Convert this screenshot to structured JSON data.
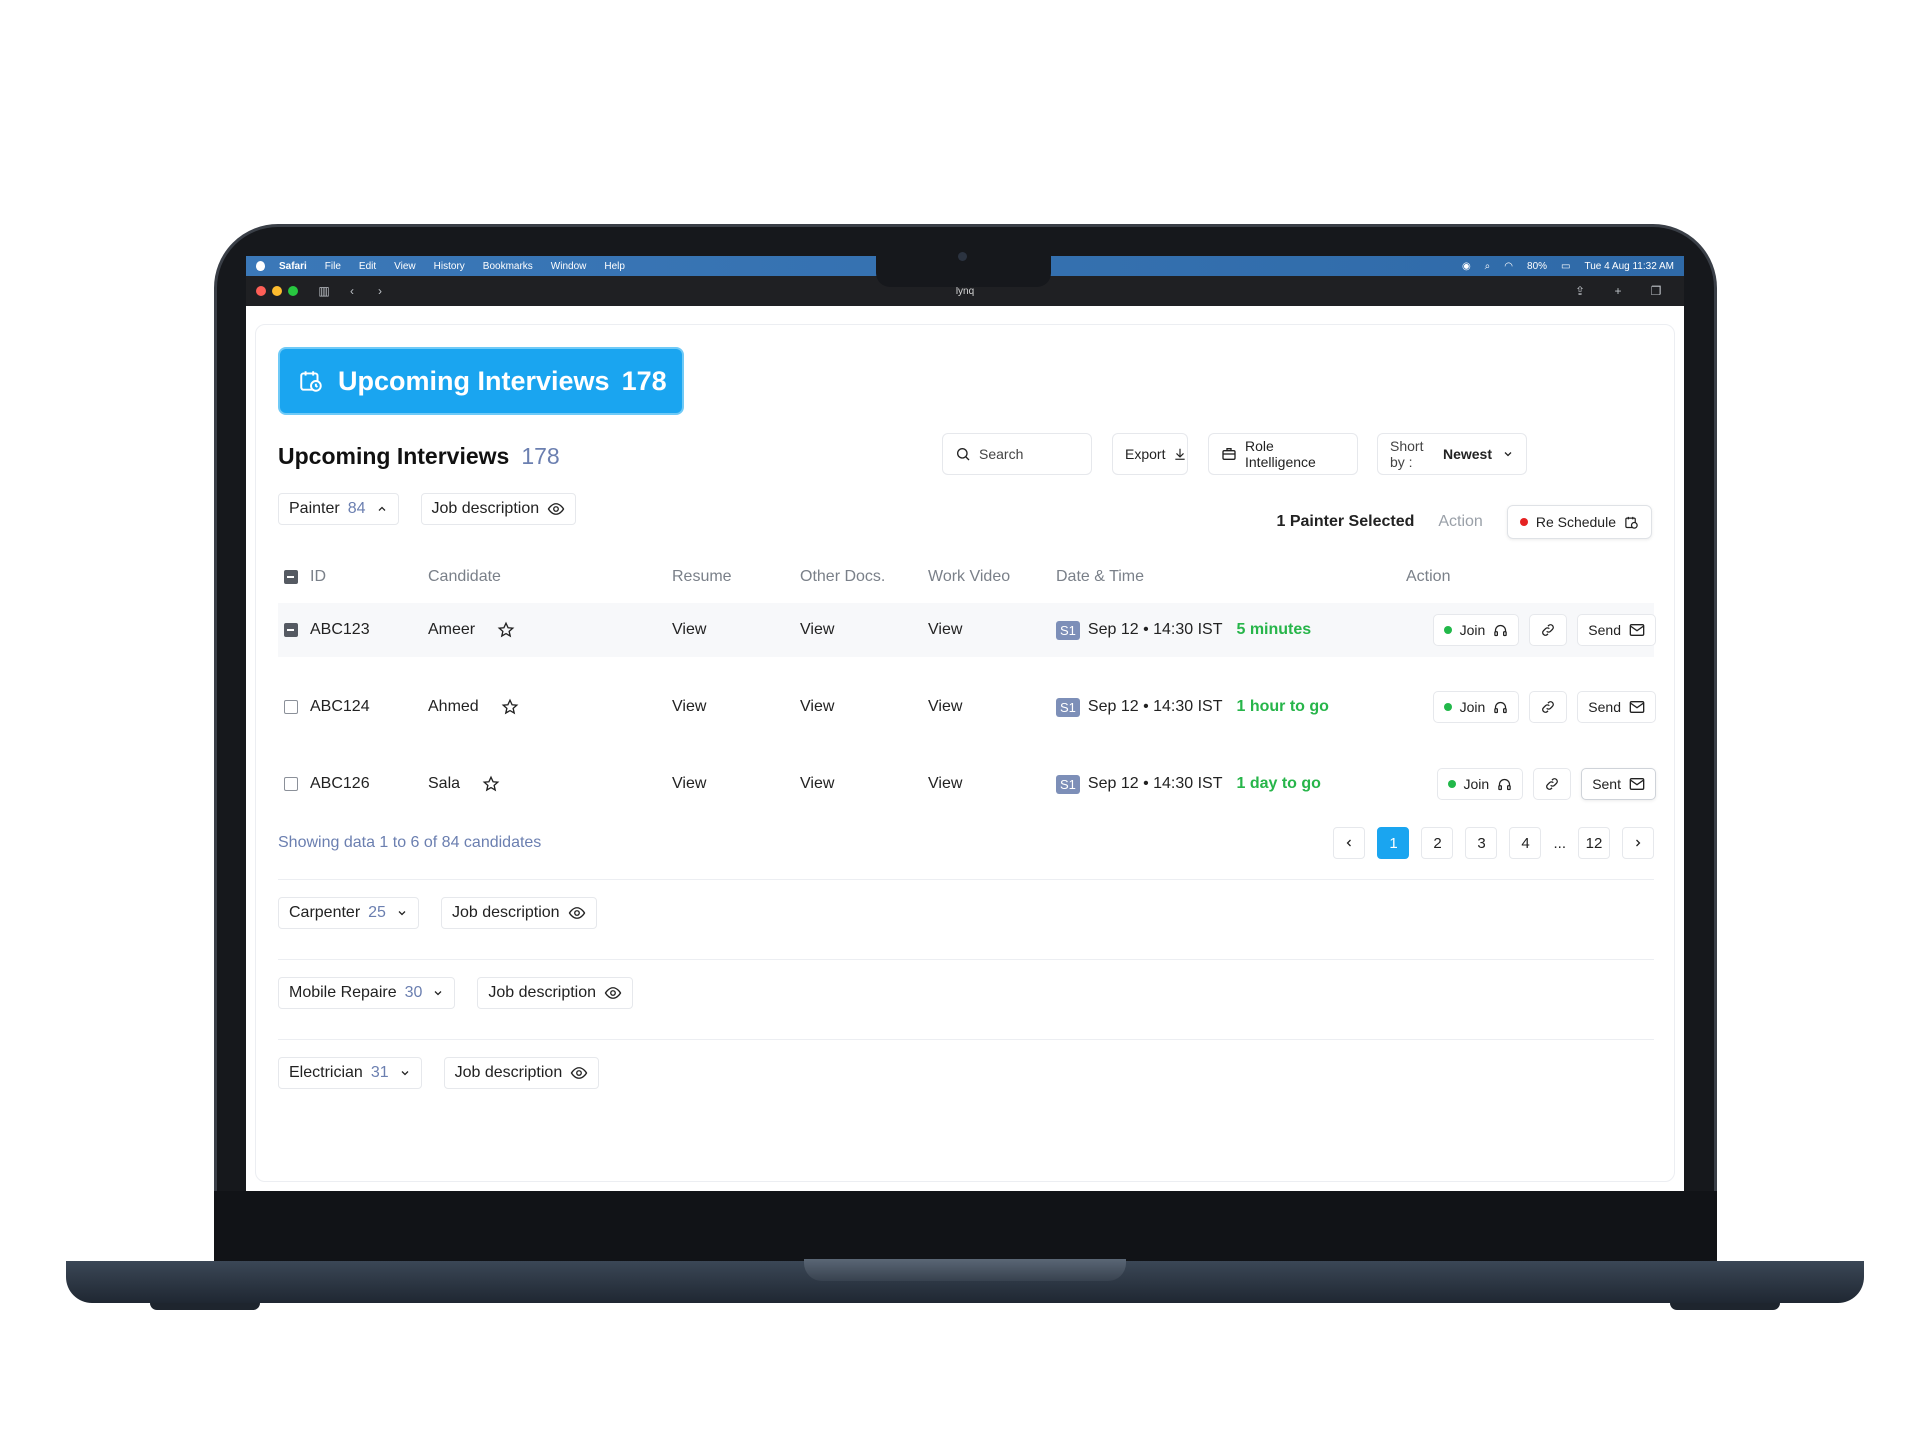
{
  "menubar": {
    "app": "Safari",
    "items": [
      "File",
      "Edit",
      "View",
      "History",
      "Bookmarks",
      "Window",
      "Help"
    ],
    "battery": "80%",
    "clock": "Tue 4 Aug  11:32 AM"
  },
  "browser": {
    "url": "lynq"
  },
  "hero": {
    "title": "Upcoming Interviews",
    "count": "178"
  },
  "header": {
    "title": "Upcoming Interviews",
    "count": "178"
  },
  "toolbar": {
    "search_placeholder": "Search",
    "export_label": "Export",
    "role_label": "Role Intelligence",
    "sort_prefix": "Short by :",
    "sort_value": "Newest"
  },
  "selection": {
    "selected": "1 Painter Selected",
    "action": "Action",
    "reschedule": "Re Schedule"
  },
  "groups": [
    {
      "name": "Painter",
      "count": "84",
      "jd": "Job description"
    },
    {
      "name": "Carpenter",
      "count": "25",
      "jd": "Job description"
    },
    {
      "name": "Mobile Repaire",
      "count": "30",
      "jd": "Job description"
    },
    {
      "name": "Electrician",
      "count": "31",
      "jd": "Job description"
    }
  ],
  "table": {
    "headers": [
      "ID",
      "Candidate",
      "Resume",
      "Other Docs.",
      "Work Video",
      "Date & Time",
      "Action"
    ],
    "rows": [
      {
        "id": "ABC123",
        "name": "Ameer",
        "resume": "View",
        "docs": "View",
        "video": "View",
        "slot": "S1",
        "datetime": "Sep 12 • 14:30 IST",
        "remaining": "5 minutes",
        "join": "Join",
        "send": "Send"
      },
      {
        "id": "ABC124",
        "name": "Ahmed",
        "resume": "View",
        "docs": "View",
        "video": "View",
        "slot": "S1",
        "datetime": "Sep 12 • 14:30 IST",
        "remaining": "1 hour to go",
        "join": "Join",
        "send": "Send"
      },
      {
        "id": "ABC126",
        "name": "Sala",
        "resume": "View",
        "docs": "View",
        "video": "View",
        "slot": "S1",
        "datetime": "Sep 12 • 14:30 IST",
        "remaining": "1 day to go",
        "join": "Join",
        "send": "Sent"
      }
    ]
  },
  "pagination": {
    "showing": "Showing data 1 to 6 of  84 candidates",
    "pages": [
      "1",
      "2",
      "3",
      "4"
    ],
    "ellipsis": "...",
    "last": "12"
  },
  "colors": {
    "accent": "#1aa5f0",
    "success": "#27b54a",
    "danger": "#e52222",
    "muted": "#6b7fb0"
  }
}
